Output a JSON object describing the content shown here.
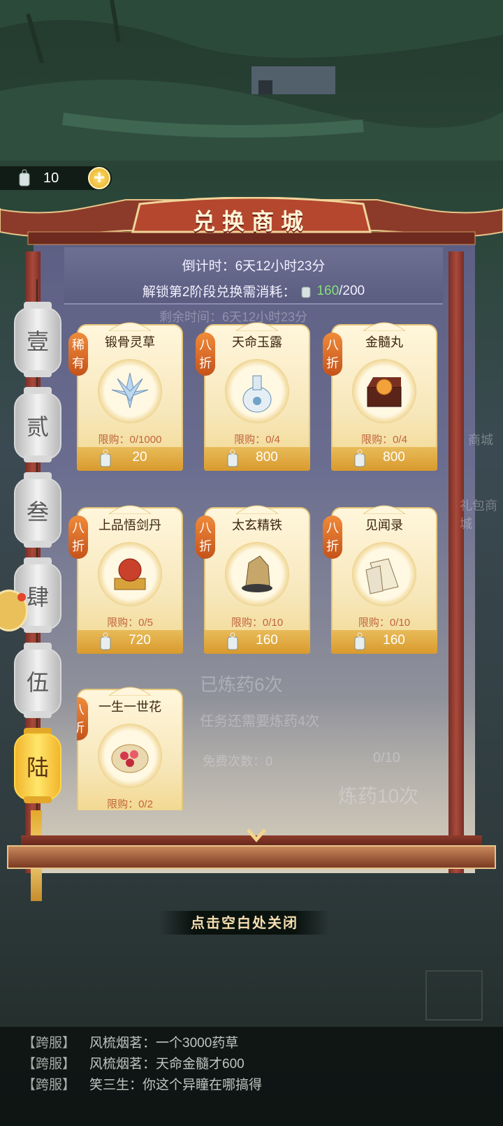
{
  "currency": {
    "amount": "10",
    "plus": "+"
  },
  "shop": {
    "title": "兑换商城",
    "countdown": "倒计时：6天12小时23分",
    "unlock_prefix": "解锁第2阶段兑换需消耗：",
    "unlock_current": "160",
    "unlock_total": "/200"
  },
  "tabs": [
    "壹",
    "贰",
    "叁",
    "肆",
    "伍",
    "陆"
  ],
  "active_tab": "陆",
  "items": [
    {
      "badge": "稀有",
      "name": "锻骨灵草",
      "limit": "限购：0/1000",
      "price": "20"
    },
    {
      "badge": "八折",
      "name": "天命玉露",
      "limit": "限购：0/4",
      "price": "800"
    },
    {
      "badge": "八折",
      "name": "金髓丸",
      "limit": "限购：0/4",
      "price": "800"
    },
    {
      "badge": "八折",
      "name": "上品悟剑丹",
      "limit": "限购：0/5",
      "price": "720"
    },
    {
      "badge": "八折",
      "name": "太玄精铁",
      "limit": "限购：0/10",
      "price": "160"
    },
    {
      "badge": "八折",
      "name": "见闻录",
      "limit": "限购：0/10",
      "price": "160"
    },
    {
      "badge": "八折",
      "name": "一生一世花",
      "limit": "限购：0/2",
      "price": ""
    }
  ],
  "background_text": {
    "remaining": "剩余时间：6天12小时23分",
    "brewed": "已炼药6次",
    "task": "任务还需要炼药4次",
    "free": "免费次数：0",
    "count": "0/10",
    "brew10": "炼药10次",
    "gift": "礼包商城",
    "shop": "商城"
  },
  "close_hint": "点击空白处关闭",
  "chat": [
    {
      "channel": "【跨服】",
      "text": "风梳烟茗：一个3000药草"
    },
    {
      "channel": "【跨服】",
      "text": "风梳烟茗：天命金髓才600"
    },
    {
      "channel": "【跨服】",
      "text": "笑三生：你这个异瞳在哪搞得"
    }
  ],
  "colors": {
    "accent": "#86e07a",
    "badge": "#d96a2a",
    "price_bar": "#e0a83c",
    "roof": "#8c3b2a"
  }
}
